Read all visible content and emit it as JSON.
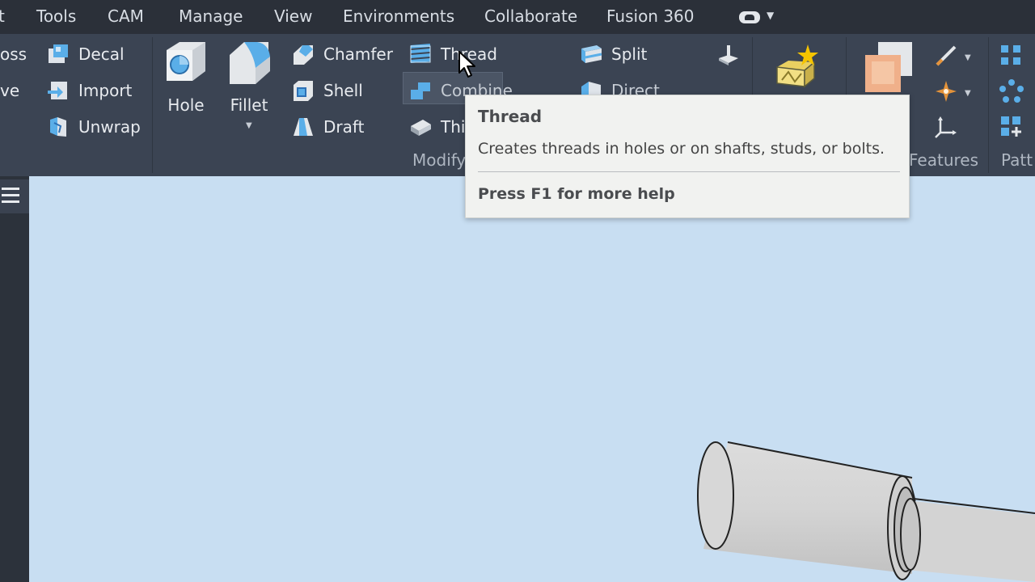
{
  "menu": {
    "items": [
      "t",
      "Tools",
      "CAM",
      "Manage",
      "View",
      "Environments",
      "Collaborate",
      "Fusion 360"
    ]
  },
  "ribbon": {
    "col1": [
      "oss",
      "ve"
    ],
    "col2": [
      "Decal",
      "Import",
      "Unwrap"
    ],
    "big": [
      "Hole",
      "Fillet"
    ],
    "col3": [
      "Chamfer",
      "Shell",
      "Draft"
    ],
    "col4": [
      "Thread",
      "Combine",
      "Thi"
    ],
    "col5": [
      "Split",
      "Direct"
    ],
    "groups": {
      "modify": "Modify",
      "features": "Features",
      "pattern": "Patt"
    }
  },
  "tooltip": {
    "title": "Thread",
    "description": "Creates threads in holes or on shafts, studs, or bolts.",
    "help": "Press F1 for more help"
  },
  "colors": {
    "menubar": "#2b3039",
    "ribbon": "#3b4453",
    "canvas": "#c8def2",
    "icon_blue": "#5aaee8",
    "tooltip_bg": "#f1f2f0"
  }
}
